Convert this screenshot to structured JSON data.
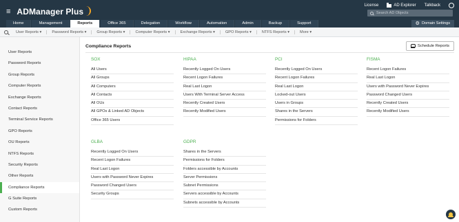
{
  "header": {
    "app_title": "ADManager Plus",
    "top_links": [
      "License",
      "AD Explorer",
      "Talkback"
    ],
    "search_placeholder": "Search AD Objects",
    "domain_settings_label": "Domain Settings",
    "tabs": [
      "Home",
      "Management",
      "Reports",
      "Office 365",
      "Delegation",
      "Workflow",
      "Automation",
      "Admin",
      "Backup",
      "Support"
    ],
    "active_tab": "Reports"
  },
  "subnav": {
    "items": [
      "User Reports",
      "Password Reports",
      "Group Reports",
      "Computer Reports",
      "Exchange Reports",
      "GPO Reports",
      "NTFS Reports",
      "More"
    ]
  },
  "sidebar": {
    "items": [
      {
        "label": "User Reports"
      },
      {
        "label": "Password Reports"
      },
      {
        "label": "Group Reports"
      },
      {
        "label": "Computer Reports"
      },
      {
        "label": "Exchange Reports"
      },
      {
        "label": "Contact Reports"
      },
      {
        "label": "Terminal Service Reports"
      },
      {
        "label": "GPO Reports"
      },
      {
        "label": "OU Reports"
      },
      {
        "label": "NTFS Reports"
      },
      {
        "label": "Security Reports"
      },
      {
        "label": "Other Reports"
      },
      {
        "label": "Compliance Reports"
      },
      {
        "label": "G Suite Reports"
      },
      {
        "label": "Custom Reports"
      }
    ],
    "active_item": "Compliance Reports",
    "accent_color": "#4caf50"
  },
  "main": {
    "title": "Compliance Reports",
    "schedule_button_label": "Schedule Reports",
    "groups": [
      {
        "name": "SOX",
        "links": [
          "All Users",
          "All Groups",
          "All Computers",
          "All Contacts",
          "All OUs",
          "All GPOs & Linked AD Objects",
          "Office 365 Users"
        ]
      },
      {
        "name": "HIPAA",
        "links": [
          "Recently Logged On Users",
          "Recent Logon Failures",
          "Real Last Logon",
          "Users With Terminal Server Access",
          "Recently Created Users",
          "Recently Modified Users"
        ]
      },
      {
        "name": "PCI",
        "links": [
          "Recently Logged On Users",
          "Recent Logon Failures",
          "Real Last Logon",
          "Locked-out Users",
          "Users in Groups",
          "Shares in the Servers",
          "Permissions for Folders"
        ]
      },
      {
        "name": "FISMA",
        "links": [
          "Recent Logon Failures",
          "Real Last Logon",
          "Users with Password Never Expires",
          "Password Changed Users",
          "Recently Created Users",
          "Recently Modified Users"
        ]
      },
      {
        "name": "GLBA",
        "links": [
          "Recently Logged On Users",
          "Recent Logon Failures",
          "Real Last Logon",
          "Users with Password Never Expires",
          "Password Changed Users",
          "Security Groups"
        ]
      },
      {
        "name": "GDPR",
        "links": [
          "Shares in the Servers",
          "Permissions for Folders",
          "Folders accessible by Accounts",
          "Server Permissions",
          "Subnet Permissions",
          "Servers accessible by Accounts",
          "Subnets accessible by Accounts"
        ]
      }
    ],
    "group_title_color": "#4caf50"
  }
}
